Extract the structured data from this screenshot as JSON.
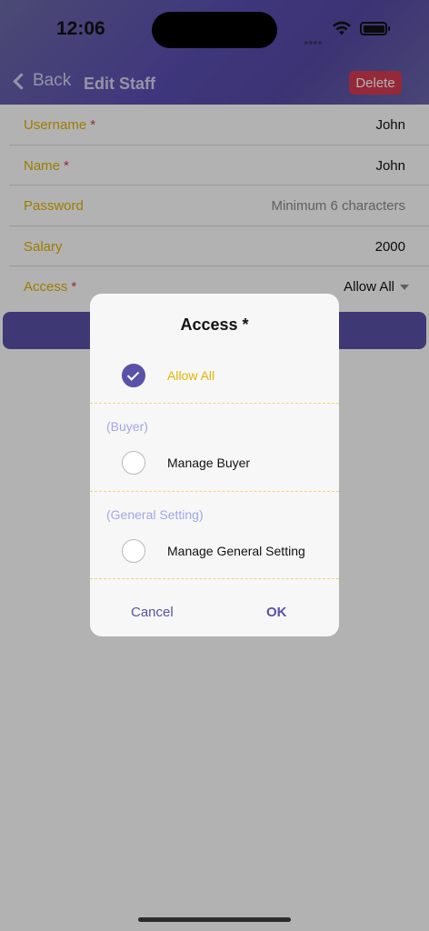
{
  "status_bar": {
    "time": "12:06",
    "icons": [
      "cellular-icon",
      "wifi-icon",
      "battery-icon"
    ]
  },
  "nav": {
    "back_label": "Back",
    "title": "Edit Staff",
    "delete_label": "Delete"
  },
  "form": {
    "fields": [
      {
        "label": "Username",
        "required": "*",
        "value": "John"
      },
      {
        "label": "Name",
        "required": "*",
        "value": "John"
      },
      {
        "label": "Password",
        "required": "",
        "placeholder": "Minimum 6 characters"
      },
      {
        "label": "Salary",
        "required": "",
        "value": "2000"
      },
      {
        "label": "Access",
        "required": "*",
        "value": "Allow All"
      }
    ]
  },
  "modal": {
    "title": "Access *",
    "allow_all": {
      "label": "Allow All",
      "checked": true
    },
    "groups": [
      {
        "name": "(Buyer)",
        "options": [
          {
            "label": "Manage Buyer",
            "checked": false
          }
        ]
      },
      {
        "name": "(General Setting)",
        "options": [
          {
            "label": "Manage General Setting",
            "checked": false
          }
        ]
      }
    ],
    "cancel_label": "Cancel",
    "ok_label": "OK"
  },
  "colors": {
    "accent": "#5a52a8",
    "label_gold": "#e0b400",
    "required_red": "#d63a52",
    "group_label": "#9fa8e6"
  }
}
